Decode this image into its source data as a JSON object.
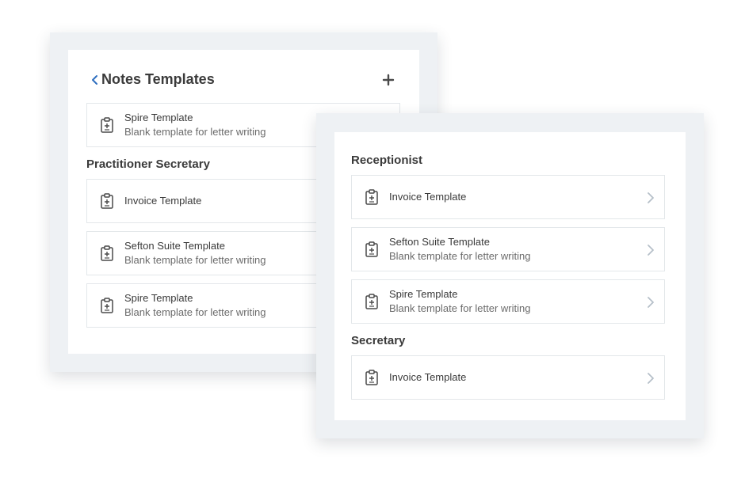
{
  "notes_panel": {
    "title": "Notes Templates",
    "top_card": {
      "name": "Spire Template",
      "description": "Blank template for letter writing"
    },
    "section": "Practitioner Secretary",
    "items": [
      {
        "name": "Invoice Template",
        "description": ""
      },
      {
        "name": "Sefton Suite Template",
        "description": "Blank template for letter writing"
      },
      {
        "name": "Spire Template",
        "description": "Blank template for letter writing"
      }
    ]
  },
  "front_panel": {
    "sections": [
      {
        "label": "Receptionist",
        "items": [
          {
            "name": "Invoice Template",
            "description": ""
          },
          {
            "name": "Sefton Suite Template",
            "description": "Blank template for letter writing"
          },
          {
            "name": "Spire Template",
            "description": "Blank template for letter writing"
          }
        ]
      },
      {
        "label": "Secretary",
        "items": [
          {
            "name": "Invoice Template",
            "description": ""
          }
        ]
      }
    ]
  },
  "icons": {
    "back": "chevron-left-icon",
    "add": "plus-icon",
    "template": "clipboard-plus-icon",
    "open": "chevron-right-icon"
  },
  "colors": {
    "accent": "#2f6fbf",
    "panel_bg": "#eef1f4",
    "card_border": "#e3e7ea",
    "text": "#3a3a3a",
    "muted_text": "#6b6b6b",
    "chevron": "#b6c0c9"
  }
}
